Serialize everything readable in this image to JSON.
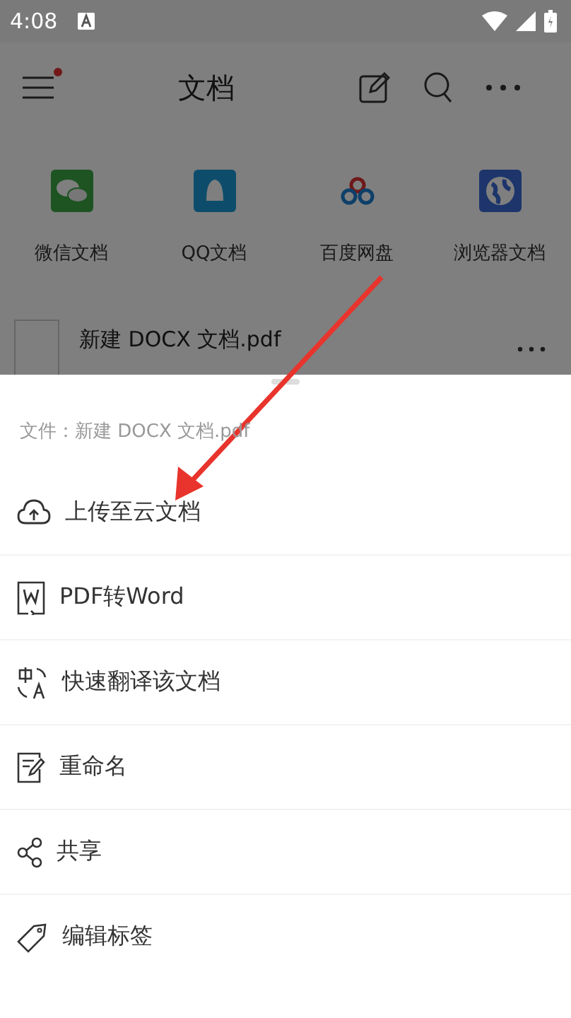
{
  "status_bar": {
    "time": "4:08"
  },
  "header": {
    "title": "文档",
    "menu_badge": true
  },
  "shortcuts": [
    {
      "label": "微信文档",
      "kind": "wechat"
    },
    {
      "label": "QQ文档",
      "kind": "qq"
    },
    {
      "label": "百度网盘",
      "kind": "baidu"
    },
    {
      "label": "浏览器文档",
      "kind": "browser"
    }
  ],
  "file": {
    "name": "新建 DOCX 文档.pdf"
  },
  "sheet": {
    "caption": "文件：新建 DOCX 文档.pdf",
    "items": [
      {
        "label": "上传至云文档",
        "kind": "upload"
      },
      {
        "label": "PDF转Word",
        "kind": "word"
      },
      {
        "label": "快速翻译该文档",
        "kind": "translate"
      },
      {
        "label": "重命名",
        "kind": "rename"
      },
      {
        "label": "共享",
        "kind": "share"
      },
      {
        "label": "编辑标签",
        "kind": "tag"
      }
    ]
  }
}
